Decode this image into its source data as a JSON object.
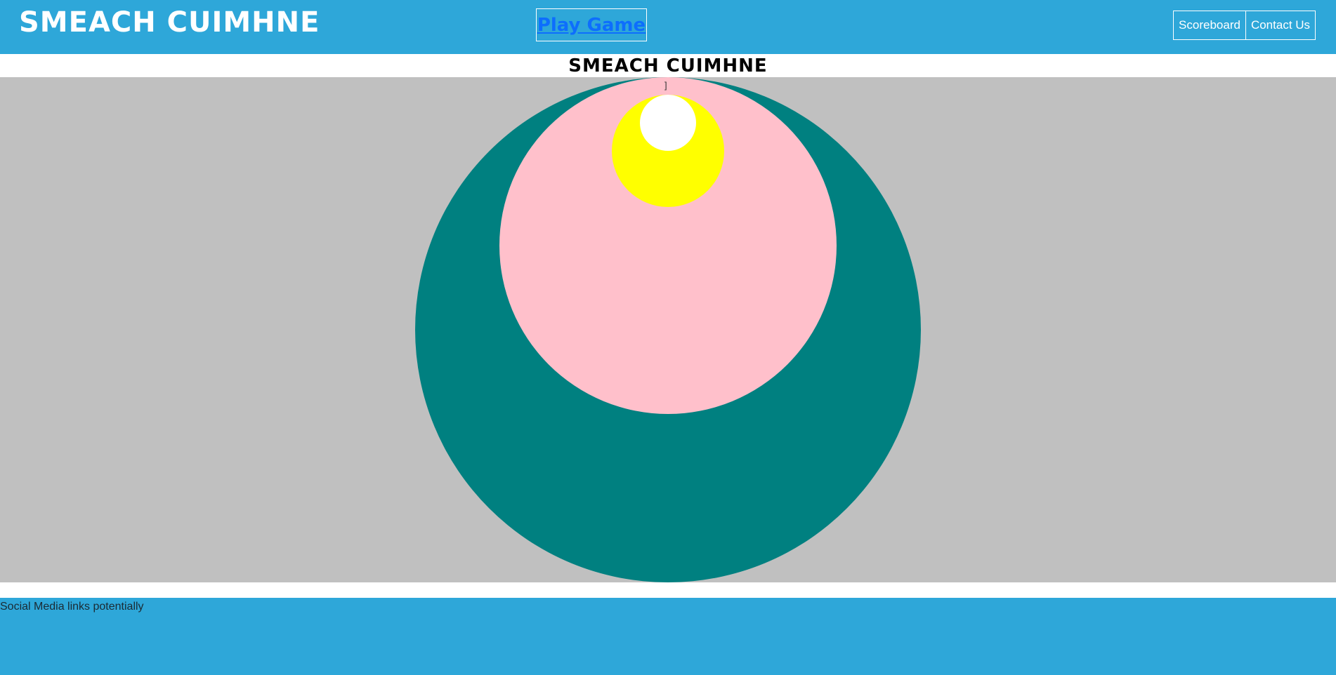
{
  "header": {
    "logo_text": "SMEACH CUIMHNE",
    "play_link_label": "Play Game",
    "nav": {
      "scoreboard_label": "Scoreboard",
      "contact_label": "Contact Us"
    }
  },
  "main": {
    "title": "SMEACH CUIMHNE",
    "game": {
      "stray_text": "]",
      "colors": {
        "background": "#c0c0c0",
        "outer_circle": "#008080",
        "middle_circle": "#ffc0cb",
        "inner_circle": "#ffff00",
        "center_circle": "#ffffff"
      }
    }
  },
  "footer": {
    "text": "Social Media links potentially"
  },
  "theme": {
    "header_bg": "#2ea7d9",
    "footer_bg": "#2ea7d9",
    "link_color": "#0d6efd"
  }
}
